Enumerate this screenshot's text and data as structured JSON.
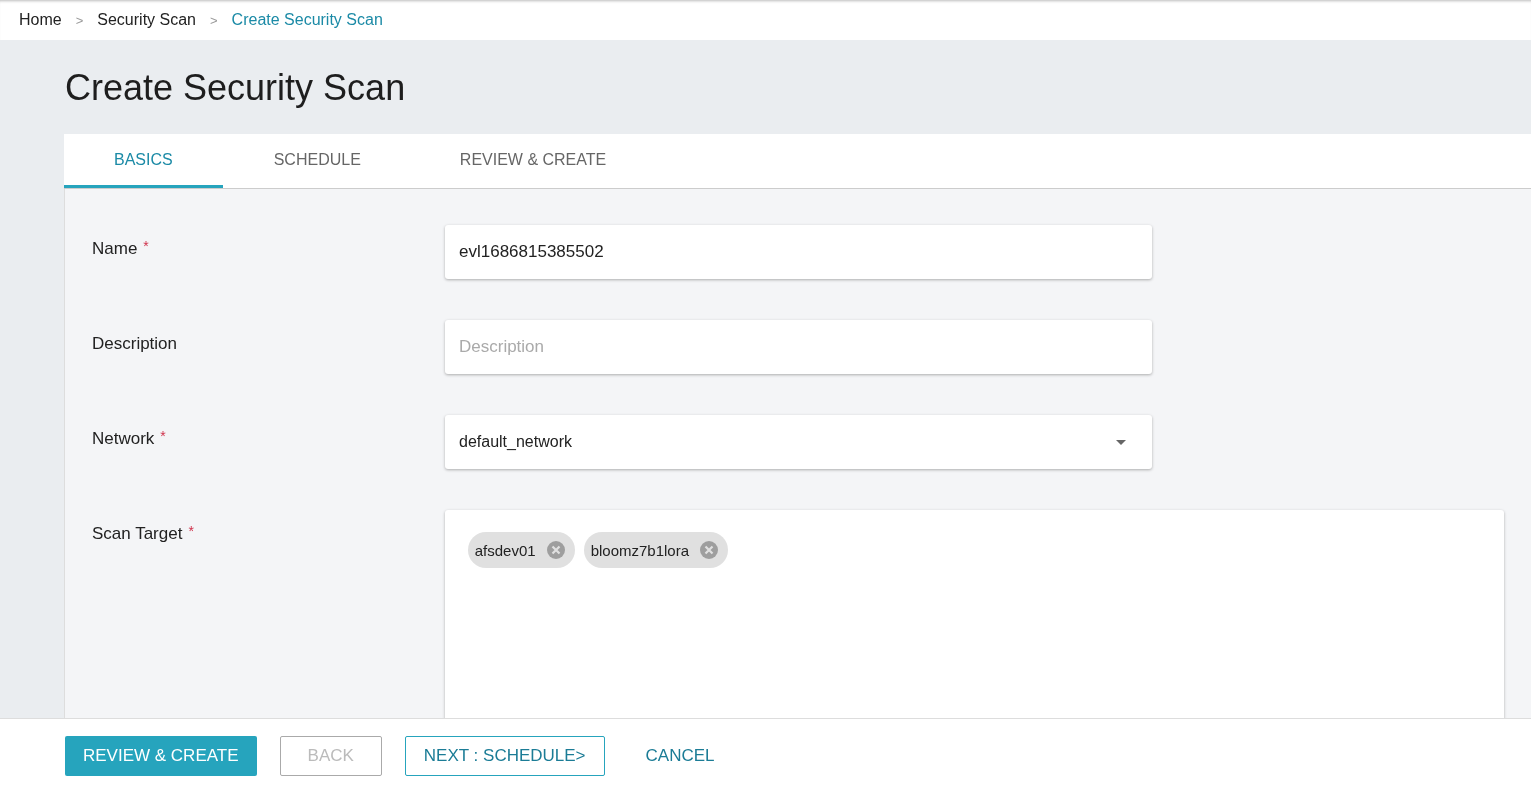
{
  "breadcrumb": [
    {
      "label": "Home",
      "current": false
    },
    {
      "label": "Security Scan",
      "current": false
    },
    {
      "label": "Create Security Scan",
      "current": true
    }
  ],
  "breadcrumb_separator": ">",
  "title": "Create Security Scan",
  "tabs": [
    {
      "label": "BASICS",
      "selected": true
    },
    {
      "label": "SCHEDULE",
      "selected": false
    },
    {
      "label": "REVIEW & CREATE",
      "selected": false
    }
  ],
  "fields": [
    {
      "label": "Name",
      "required": true,
      "kind": "text",
      "value": "evl1686815385502"
    },
    {
      "label": "Description",
      "required": false,
      "kind": "text",
      "placeholder": "Description"
    },
    {
      "label": "Network",
      "required": true,
      "kind": "select",
      "value": "default_network"
    },
    {
      "label": "Scan Target",
      "required": true,
      "kind": "tags",
      "tags": [
        "afsdev01",
        "bloomz7b1lora"
      ]
    }
  ],
  "required_mark": "*",
  "buttons": [
    {
      "label": "REVIEW & CREATE",
      "kind": "primary",
      "disabled": false
    },
    {
      "label": "BACK",
      "kind": "outlined",
      "disabled": true
    },
    {
      "label": "NEXT : SCHEDULE>",
      "kind": "outlined",
      "disabled": false
    },
    {
      "label": "CANCEL",
      "kind": "text",
      "disabled": false
    }
  ]
}
